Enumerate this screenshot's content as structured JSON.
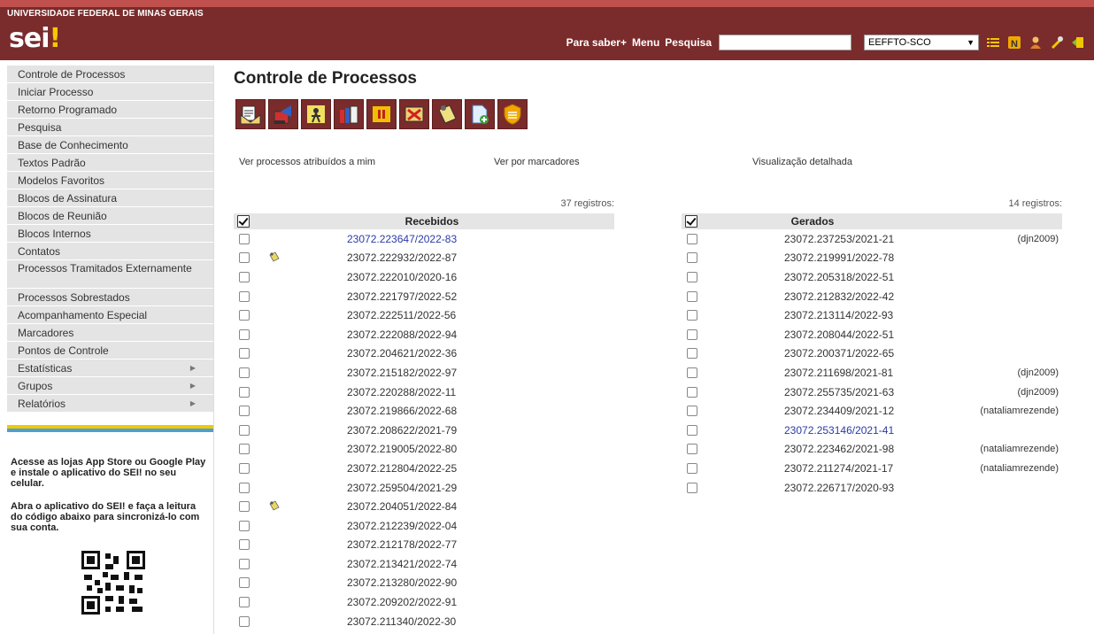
{
  "header": {
    "university": "UNIVERSIDADE FEDERAL DE MINAS GERAIS",
    "logo": "sei",
    "logo_bang": "!",
    "links": [
      "Para saber+",
      "Menu",
      "Pesquisa"
    ],
    "search_value": "",
    "unit": "EEFFTO-SCO"
  },
  "sidebar": {
    "items": [
      {
        "label": "Controle de Processos"
      },
      {
        "label": "Iniciar Processo"
      },
      {
        "label": "Retorno Programado"
      },
      {
        "label": "Pesquisa"
      },
      {
        "label": "Base de Conhecimento"
      },
      {
        "label": "Textos Padrão"
      },
      {
        "label": "Modelos Favoritos"
      },
      {
        "label": "Blocos de Assinatura"
      },
      {
        "label": "Blocos de Reunião"
      },
      {
        "label": "Blocos Internos"
      },
      {
        "label": "Contatos"
      },
      {
        "label": "Processos Tramitados Externamente"
      },
      {
        "label": "Processos Sobrestados"
      },
      {
        "label": "Acompanhamento Especial"
      },
      {
        "label": "Marcadores"
      },
      {
        "label": "Pontos de Controle"
      },
      {
        "label": "Estatísticas"
      },
      {
        "label": "Grupos"
      },
      {
        "label": "Relatórios"
      }
    ],
    "promo_1": "Acesse as lojas App Store ou Google Play e instale o aplicativo do SEI! no seu celular.",
    "promo_2": "Abra o aplicativo do SEI! e faça a leitura do código abaixo para sincronizá-lo com sua conta."
  },
  "main": {
    "title": "Controle de Processos",
    "toolbar": [
      "send-process-icon",
      "forward-process-icon",
      "assign-icon",
      "books-icon",
      "suspend-icon",
      "close-process-icon",
      "notes-icon",
      "new-document-icon",
      "shield-icon"
    ],
    "links": {
      "assigned": "Ver processos atribuídos a mim",
      "markers": "Ver por marcadores",
      "detailed": "Visualização detalhada"
    },
    "received": {
      "count": "37 registros:",
      "header": "Recebidos",
      "rows": [
        {
          "id": "23072.223647/2022-83",
          "note": false,
          "visited": true
        },
        {
          "id": "23072.222932/2022-87",
          "note": true,
          "visited": false
        },
        {
          "id": "23072.222010/2020-16",
          "note": false,
          "visited": false
        },
        {
          "id": "23072.221797/2022-52",
          "note": false,
          "visited": false
        },
        {
          "id": "23072.222511/2022-56",
          "note": false,
          "visited": false
        },
        {
          "id": "23072.222088/2022-94",
          "note": false,
          "visited": false
        },
        {
          "id": "23072.204621/2022-36",
          "note": false,
          "visited": false
        },
        {
          "id": "23072.215182/2022-97",
          "note": false,
          "visited": false
        },
        {
          "id": "23072.220288/2022-11",
          "note": false,
          "visited": false
        },
        {
          "id": "23072.219866/2022-68",
          "note": false,
          "visited": false
        },
        {
          "id": "23072.208622/2021-79",
          "note": false,
          "visited": false
        },
        {
          "id": "23072.219005/2022-80",
          "note": false,
          "visited": false
        },
        {
          "id": "23072.212804/2022-25",
          "note": false,
          "visited": false
        },
        {
          "id": "23072.259504/2021-29",
          "note": false,
          "visited": false
        },
        {
          "id": "23072.204051/2022-84",
          "note": true,
          "visited": false
        },
        {
          "id": "23072.212239/2022-04",
          "note": false,
          "visited": false
        },
        {
          "id": "23072.212178/2022-77",
          "note": false,
          "visited": false
        },
        {
          "id": "23072.213421/2022-74",
          "note": false,
          "visited": false
        },
        {
          "id": "23072.213280/2022-90",
          "note": false,
          "visited": false
        },
        {
          "id": "23072.209202/2022-91",
          "note": false,
          "visited": false
        },
        {
          "id": "23072.211340/2022-30",
          "note": false,
          "visited": false
        }
      ]
    },
    "generated": {
      "count": "14 registros:",
      "header": "Gerados",
      "rows": [
        {
          "id": "23072.237253/2021-21",
          "user": "(djn2009)",
          "visited": false
        },
        {
          "id": "23072.219991/2022-78",
          "user": "",
          "visited": false
        },
        {
          "id": "23072.205318/2022-51",
          "user": "",
          "visited": false
        },
        {
          "id": "23072.212832/2022-42",
          "user": "",
          "visited": false
        },
        {
          "id": "23072.213114/2022-93",
          "user": "",
          "visited": false
        },
        {
          "id": "23072.208044/2022-51",
          "user": "",
          "visited": false
        },
        {
          "id": "23072.200371/2022-65",
          "user": "",
          "visited": false
        },
        {
          "id": "23072.211698/2021-81",
          "user": "(djn2009)",
          "visited": false
        },
        {
          "id": "23072.255735/2021-63",
          "user": "(djn2009)",
          "visited": false
        },
        {
          "id": "23072.234409/2021-12",
          "user": "(nataliamrezende)",
          "visited": false
        },
        {
          "id": "23072.253146/2021-41",
          "user": "",
          "visited": true
        },
        {
          "id": "23072.223462/2021-98",
          "user": "(nataliamrezende)",
          "visited": false
        },
        {
          "id": "23072.211274/2021-17",
          "user": "(nataliamrezende)",
          "visited": false
        },
        {
          "id": "23072.226717/2020-93",
          "user": "",
          "visited": false
        }
      ]
    }
  }
}
